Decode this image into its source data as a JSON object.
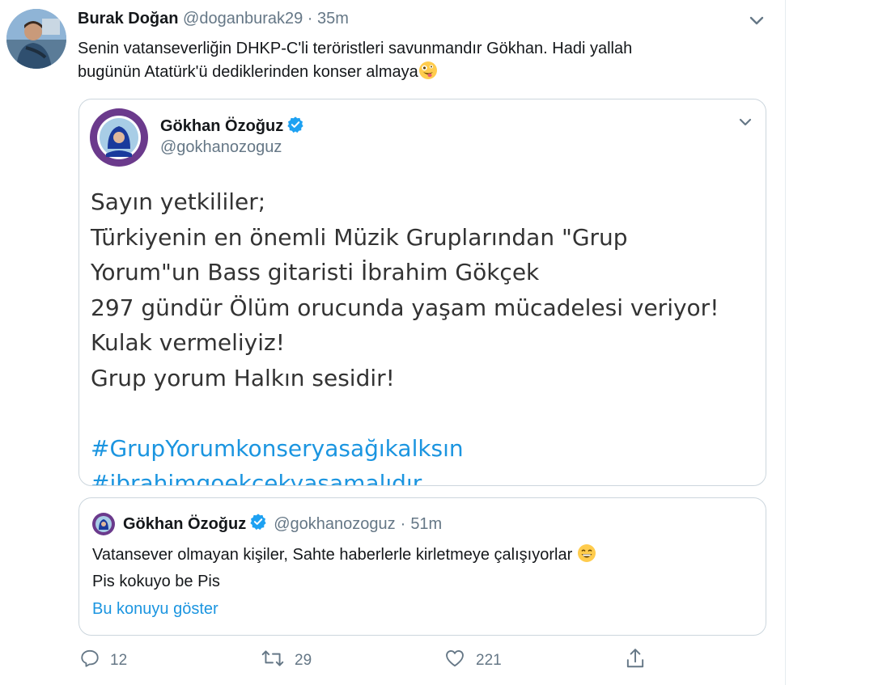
{
  "tweet": {
    "author_name": "Burak Doğan",
    "author_handle": "@doganburak29",
    "separator": "·",
    "time": "35m",
    "text_lines": [
      "Senin vatanseverliğin DHKP-C'li teröristleri savunmandır Gökhan. Hadi yallah",
      "bugünün Atatürk'ü dediklerinden konser almaya"
    ],
    "text_emoji": "zany-face-emoji"
  },
  "embed": {
    "author_name": "Gökhan Özoğuz",
    "author_handle": "@gokhanozoguz",
    "lines": [
      "Sayın yetkililer;",
      "Türkiyenin en önemli Müzik Gruplarından \"Grup",
      "Yorum\"un Bass gitaristi İbrahim Gökçek",
      "297 gündür Ölüm orucunda yaşam mücadelesi veriyor!",
      "Kulak vermeliyiz!",
      "Grup yorum Halkın sesidir!"
    ],
    "hashtags": [
      "#GrupYorumkonseryasağıkalksın",
      "#ibrahimgoekcekyasamalıdır"
    ]
  },
  "quote": {
    "author_name": "Gökhan Özoğuz",
    "author_handle": "@gokhanozoguz",
    "separator": "·",
    "time": "51m",
    "lines": [
      "Vatansever olmayan kişiler, Sahte haberlerle kirletmeye çalışıyorlar",
      "Pis kokuyo be Pis"
    ],
    "line_emoji": "grinning-face-emoji",
    "show_thread": "Bu konuyu göster"
  },
  "actions": {
    "reply_count": "12",
    "retweet_count": "29",
    "like_count": "221"
  },
  "colors": {
    "link": "#1b95e0",
    "muted": "#657786",
    "border": "#ccd6dd",
    "verified": "#1da1f2"
  }
}
